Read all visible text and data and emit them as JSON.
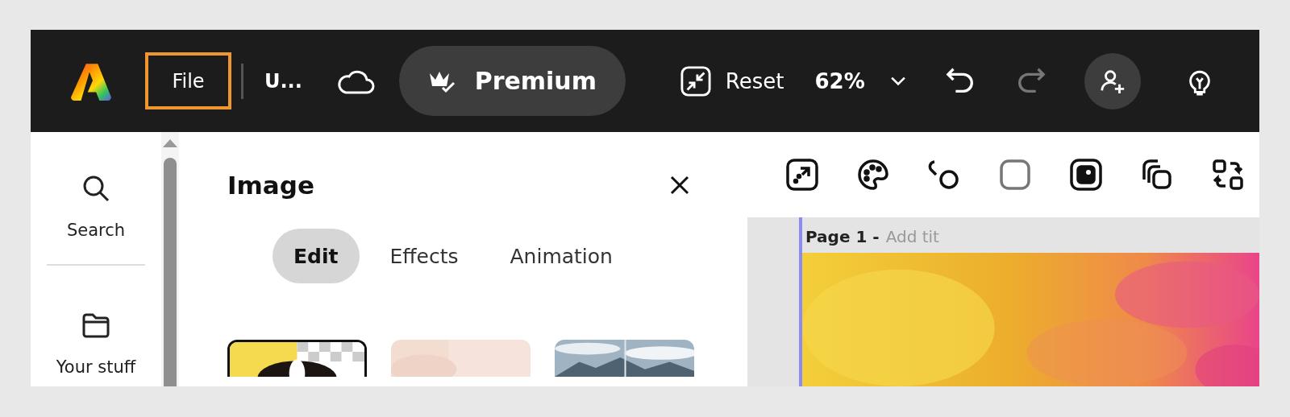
{
  "toolbar": {
    "file_menu": {
      "label": "File",
      "highlighted": true
    },
    "doc_title": "U...",
    "premium": "Premium",
    "reset": "Reset",
    "zoom": "62%",
    "undo_disabled": false,
    "redo_disabled": true
  },
  "sidebar": {
    "items": [
      {
        "label": "Search",
        "kind": "search"
      },
      {
        "label": "Your stuff",
        "kind": "folder"
      }
    ]
  },
  "panel": {
    "title": "Image",
    "tabs": [
      {
        "label": "Edit",
        "selected": true
      },
      {
        "label": "Effects",
        "selected": false
      },
      {
        "label": "Animation",
        "selected": false
      }
    ]
  },
  "canvas": {
    "page_label": "Page 1 -",
    "title_placeholder": "Add tit"
  }
}
